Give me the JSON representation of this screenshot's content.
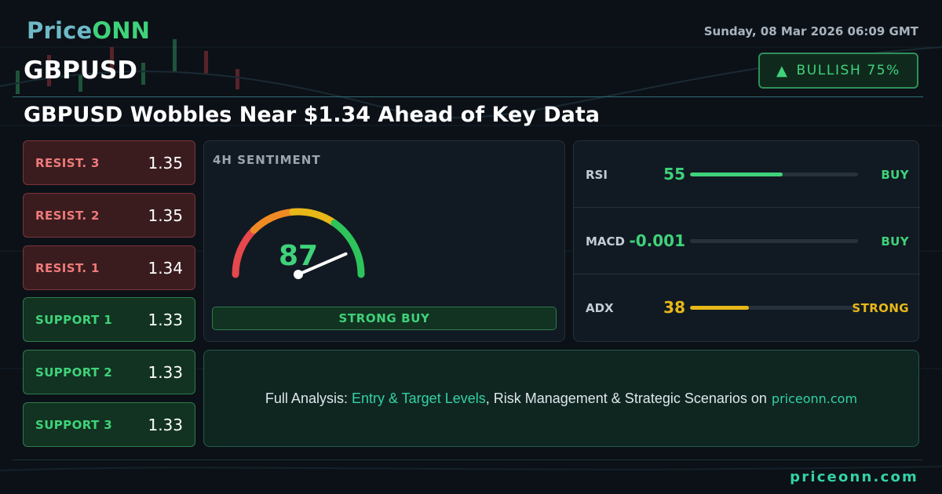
{
  "brand": {
    "logo_part1": "Price",
    "logo_part2": "ONN"
  },
  "datetime": "Sunday, 08 Mar 2026 06:09 GMT",
  "symbol": "GBPUSD",
  "bias": {
    "label": "BULLISH 75%",
    "icon": "triangle-up-icon",
    "color": "#3fd27a"
  },
  "headline": "GBPUSD Wobbles Near $1.34 Ahead of Key Data",
  "levels": [
    {
      "name": "RESIST. 3",
      "value": "1.35",
      "kind": "resistance"
    },
    {
      "name": "RESIST. 2",
      "value": "1.35",
      "kind": "resistance"
    },
    {
      "name": "RESIST. 1",
      "value": "1.34",
      "kind": "resistance"
    },
    {
      "name": "SUPPORT 1",
      "value": "1.33",
      "kind": "support"
    },
    {
      "name": "SUPPORT 2",
      "value": "1.33",
      "kind": "support"
    },
    {
      "name": "SUPPORT 3",
      "value": "1.33",
      "kind": "support"
    }
  ],
  "sentiment": {
    "title": "4H SENTIMENT",
    "value": "87",
    "score": 87,
    "label": "STRONG BUY",
    "arc_colors": [
      "#e5484d",
      "#f08a24",
      "#e8b818",
      "#2ec45c"
    ]
  },
  "indicators": [
    {
      "name": "RSI",
      "value": "55",
      "fill": 0.55,
      "signal": "BUY",
      "color": "#3fd27a"
    },
    {
      "name": "MACD",
      "value": "-0.001",
      "fill": 0,
      "signal": "BUY",
      "color": "#3fd27a"
    },
    {
      "name": "ADX",
      "value": "38",
      "fill": 0.35,
      "signal": "STRONG",
      "color": "#e8b818"
    }
  ],
  "cta": {
    "prefix": "Full Analysis: ",
    "highlight": "Entry & Target Levels",
    "middle": ", Risk Management & Strategic Scenarios on",
    "site": "priceonn.com"
  },
  "footer_url": "priceonn.com"
}
